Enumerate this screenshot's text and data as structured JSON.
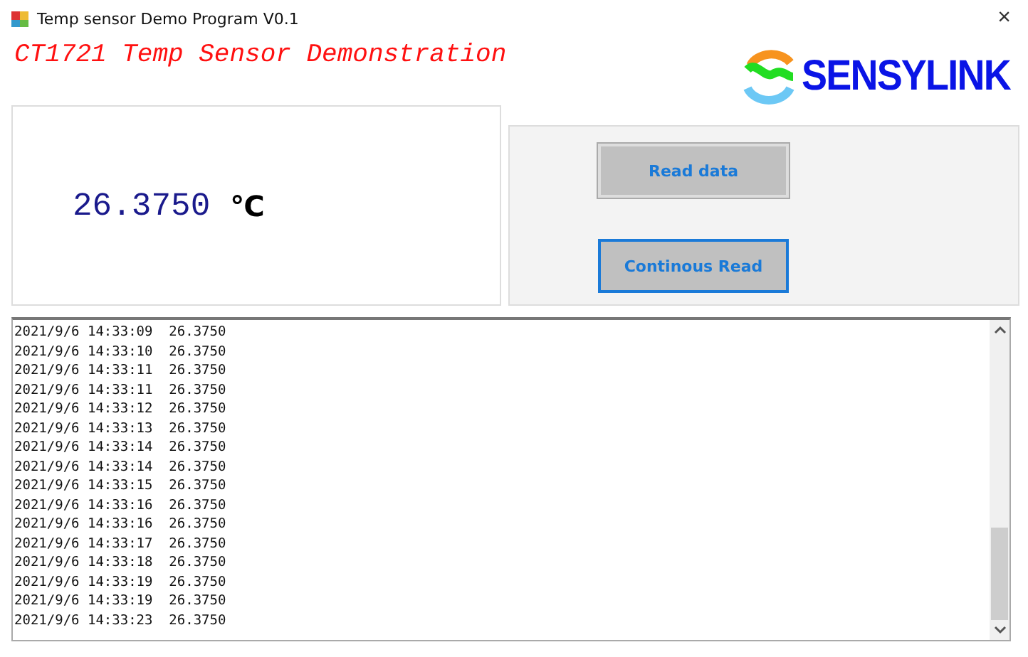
{
  "window": {
    "title": "Temp sensor Demo Program V0.1",
    "close": "×"
  },
  "heading": "CT1721 Temp Sensor Demonstration",
  "logo": {
    "text": "SENSYLINK"
  },
  "reading": {
    "value": "26.3750",
    "unit": "℃"
  },
  "buttons": [
    {
      "label": "Read data",
      "focused": false
    },
    {
      "label": "Continous Read",
      "focused": true
    }
  ],
  "log": [
    "2021/9/6 14:33:09  26.3750",
    "2021/9/6 14:33:10  26.3750",
    "2021/9/6 14:33:11  26.3750",
    "2021/9/6 14:33:11  26.3750",
    "2021/9/6 14:33:12  26.3750",
    "2021/9/6 14:33:13  26.3750",
    "2021/9/6 14:33:14  26.3750",
    "2021/9/6 14:33:14  26.3750",
    "2021/9/6 14:33:15  26.3750",
    "2021/9/6 14:33:16  26.3750",
    "2021/9/6 14:33:16  26.3750",
    "2021/9/6 14:33:17  26.3750",
    "2021/9/6 14:33:18  26.3750",
    "2021/9/6 14:33:19  26.3750",
    "2021/9/6 14:33:19  26.3750",
    "2021/9/6 14:33:23  26.3750"
  ]
}
